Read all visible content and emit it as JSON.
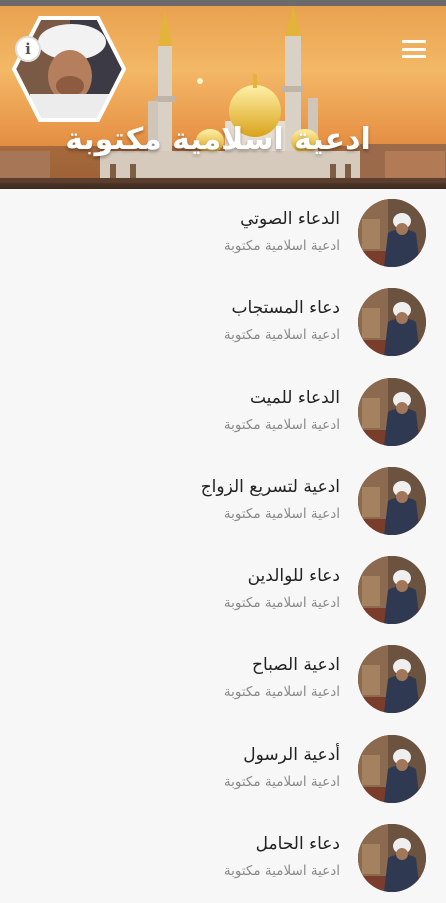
{
  "header": {
    "title": "ادعية اسلامية مكتوبة"
  },
  "colors": {
    "sky": "#f3b866",
    "background": "#f7f7f7",
    "title_text": "#222222",
    "subtitle_text": "#8a8a8a"
  },
  "icons": {
    "info": "info-icon",
    "menu": "hamburger-menu-icon"
  },
  "list": [
    {
      "title": "الدعاء الصوتي",
      "subtitle": "ادعية اسلامية مكتوبة"
    },
    {
      "title": "دعاء المستجاب",
      "subtitle": "ادعية اسلامية مكتوبة"
    },
    {
      "title": "الدعاء للميت",
      "subtitle": "ادعية اسلامية مكتوبة"
    },
    {
      "title": "ادعية لتسريع الزواج",
      "subtitle": "ادعية اسلامية مكتوبة"
    },
    {
      "title": "دعاء للوالدين",
      "subtitle": "ادعية اسلامية مكتوبة"
    },
    {
      "title": "ادعية الصباح",
      "subtitle": "ادعية اسلامية مكتوبة"
    },
    {
      "title": "أدعية الرسول",
      "subtitle": "ادعية اسلامية مكتوبة"
    },
    {
      "title": "دعاء الحامل",
      "subtitle": "ادعية اسلامية مكتوبة"
    }
  ]
}
